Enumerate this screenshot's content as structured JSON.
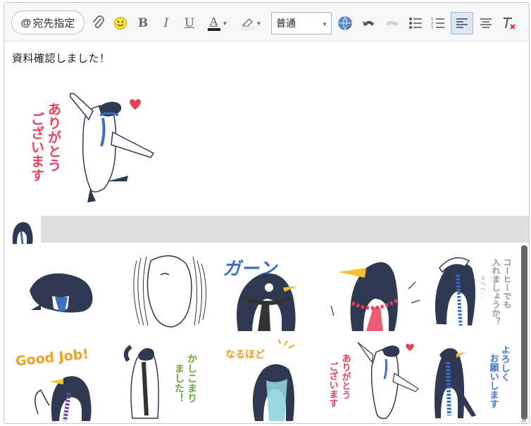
{
  "toolbar": {
    "mention_label": "宛先指定",
    "mention_at": "@",
    "bold_label": "B",
    "italic_label": "I",
    "underline_label": "U",
    "font_color_label": "A",
    "font_size_value": "普通",
    "icons": [
      "attachment-icon",
      "emoji-icon",
      "highlighter-icon",
      "link-globe-icon",
      "undo-icon",
      "redo-icon",
      "bullet-list-icon",
      "numbered-list-icon",
      "align-left-icon",
      "align-center-icon",
      "clear-format-icon"
    ]
  },
  "message": {
    "text": "資料確認しました！",
    "sticker_caption_lines": [
      "ありがとう",
      "ございます"
    ]
  },
  "picker": {
    "stickers": [
      {
        "name": "penguin-bowing",
        "caption": ""
      },
      {
        "name": "penguin-shocked",
        "caption": ""
      },
      {
        "name": "penguin-ganbaru",
        "caption": "ガーン"
      },
      {
        "name": "penguin-shouting",
        "caption": ""
      },
      {
        "name": "penguin-coffee",
        "caption": "コーヒーでも入れましょうか？",
        "sub": "えへへ..."
      },
      {
        "name": "penguin-good-job",
        "caption": "Good Job!"
      },
      {
        "name": "penguin-kashikomari",
        "caption": "かしこまりました！"
      },
      {
        "name": "penguin-naruhodo",
        "caption": "なるほど"
      },
      {
        "name": "penguin-arigatou",
        "caption": "ありがとうございます"
      },
      {
        "name": "penguin-yoroshiku",
        "caption": "よろしくお願いします"
      }
    ]
  },
  "colors": {
    "penguin_body": "#2f3a52",
    "tie_blue": "#3a6fc9",
    "red_text": "#e84057",
    "green_text": "#6aa83a",
    "orange_text": "#f0a020",
    "blue_text": "#4a78c8"
  }
}
